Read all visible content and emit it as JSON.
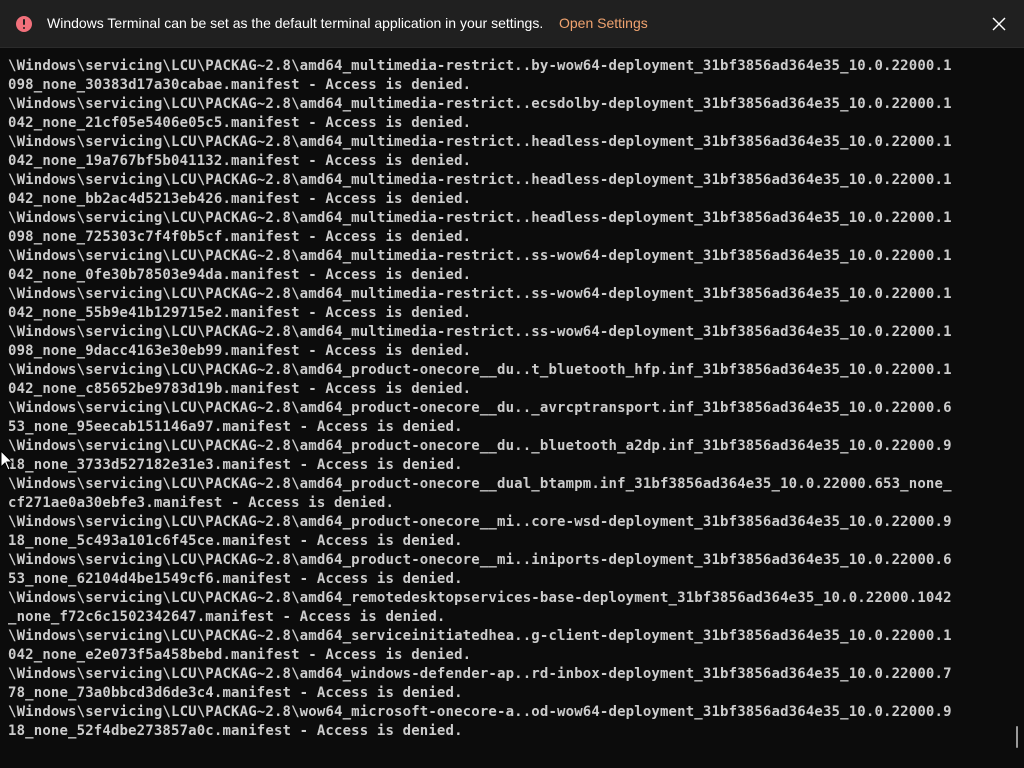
{
  "infobar": {
    "icon": "error-icon",
    "message": "Windows Terminal can be set as the default terminal application in your settings.",
    "link_label": "Open Settings",
    "close_icon": "close-icon",
    "accent_color": "#f1707b",
    "link_color": "#f0a36f"
  },
  "terminal": {
    "lines": [
      "\\Windows\\servicing\\LCU\\PACKAG~2.8\\amd64_multimedia-restrict..by-wow64-deployment_31bf3856ad364e35_10.0.22000.1",
      "098_none_30383d17a30cabae.manifest - Access is denied.",
      "\\Windows\\servicing\\LCU\\PACKAG~2.8\\amd64_multimedia-restrict..ecsdolby-deployment_31bf3856ad364e35_10.0.22000.1",
      "042_none_21cf05e5406e05c5.manifest - Access is denied.",
      "\\Windows\\servicing\\LCU\\PACKAG~2.8\\amd64_multimedia-restrict..headless-deployment_31bf3856ad364e35_10.0.22000.1",
      "042_none_19a767bf5b041132.manifest - Access is denied.",
      "\\Windows\\servicing\\LCU\\PACKAG~2.8\\amd64_multimedia-restrict..headless-deployment_31bf3856ad364e35_10.0.22000.1",
      "042_none_bb2ac4d5213eb426.manifest - Access is denied.",
      "\\Windows\\servicing\\LCU\\PACKAG~2.8\\amd64_multimedia-restrict..headless-deployment_31bf3856ad364e35_10.0.22000.1",
      "098_none_725303c7f4f0b5cf.manifest - Access is denied.",
      "\\Windows\\servicing\\LCU\\PACKAG~2.8\\amd64_multimedia-restrict..ss-wow64-deployment_31bf3856ad364e35_10.0.22000.1",
      "042_none_0fe30b78503e94da.manifest - Access is denied.",
      "\\Windows\\servicing\\LCU\\PACKAG~2.8\\amd64_multimedia-restrict..ss-wow64-deployment_31bf3856ad364e35_10.0.22000.1",
      "042_none_55b9e41b129715e2.manifest - Access is denied.",
      "\\Windows\\servicing\\LCU\\PACKAG~2.8\\amd64_multimedia-restrict..ss-wow64-deployment_31bf3856ad364e35_10.0.22000.1",
      "098_none_9dacc4163e30eb99.manifest - Access is denied.",
      "\\Windows\\servicing\\LCU\\PACKAG~2.8\\amd64_product-onecore__du..t_bluetooth_hfp.inf_31bf3856ad364e35_10.0.22000.1",
      "042_none_c85652be9783d19b.manifest - Access is denied.",
      "\\Windows\\servicing\\LCU\\PACKAG~2.8\\amd64_product-onecore__du.._avrcptransport.inf_31bf3856ad364e35_10.0.22000.6",
      "53_none_95eecab151146a97.manifest - Access is denied.",
      "\\Windows\\servicing\\LCU\\PACKAG~2.8\\amd64_product-onecore__du.._bluetooth_a2dp.inf_31bf3856ad364e35_10.0.22000.9",
      "18_none_3733d527182e31e3.manifest - Access is denied.",
      "\\Windows\\servicing\\LCU\\PACKAG~2.8\\amd64_product-onecore__dual_btampm.inf_31bf3856ad364e35_10.0.22000.653_none_",
      "cf271ae0a30ebfe3.manifest - Access is denied.",
      "\\Windows\\servicing\\LCU\\PACKAG~2.8\\amd64_product-onecore__mi..core-wsd-deployment_31bf3856ad364e35_10.0.22000.9",
      "18_none_5c493a101c6f45ce.manifest - Access is denied.",
      "\\Windows\\servicing\\LCU\\PACKAG~2.8\\amd64_product-onecore__mi..iniports-deployment_31bf3856ad364e35_10.0.22000.6",
      "53_none_62104d4be1549cf6.manifest - Access is denied.",
      "\\Windows\\servicing\\LCU\\PACKAG~2.8\\amd64_remotedesktopservices-base-deployment_31bf3856ad364e35_10.0.22000.1042",
      "_none_f72c6c1502342647.manifest - Access is denied.",
      "\\Windows\\servicing\\LCU\\PACKAG~2.8\\amd64_serviceinitiatedhea..g-client-deployment_31bf3856ad364e35_10.0.22000.1",
      "042_none_e2e073f5a458bebd.manifest - Access is denied.",
      "\\Windows\\servicing\\LCU\\PACKAG~2.8\\amd64_windows-defender-ap..rd-inbox-deployment_31bf3856ad364e35_10.0.22000.7",
      "78_none_73a0bbcd3d6de3c4.manifest - Access is denied.",
      "\\Windows\\servicing\\LCU\\PACKAG~2.8\\wow64_microsoft-onecore-a..od-wow64-deployment_31bf3856ad364e35_10.0.22000.9",
      "18_none_52f4dbe273857a0c.manifest - Access is denied."
    ]
  },
  "icons": {
    "pointer": "mouse-pointer-icon"
  }
}
